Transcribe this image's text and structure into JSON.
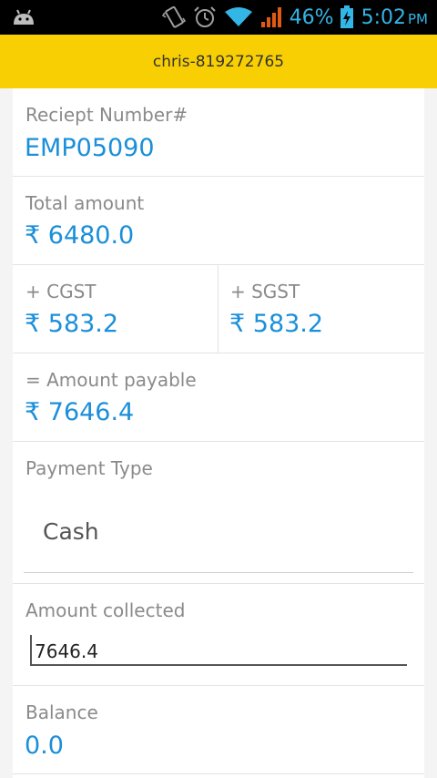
{
  "status_bar": {
    "battery_percent": "46%",
    "time": "5:02",
    "ampm": "PM",
    "icons": [
      "android-icon",
      "vibrate-icon",
      "alarm-icon",
      "wifi-icon",
      "signal-icon",
      "battery-charging-icon"
    ]
  },
  "header": {
    "title": "chris-819272765"
  },
  "receipt": {
    "label": "Reciept Number#",
    "value": "EMP05090"
  },
  "total": {
    "label": "Total amount",
    "value": "₹ 6480.0"
  },
  "cgst": {
    "label": "+ CGST",
    "value": "₹ 583.2"
  },
  "sgst": {
    "label": "+ SGST",
    "value": "₹ 583.2"
  },
  "payable": {
    "label": "= Amount payable",
    "value": "₹ 7646.4"
  },
  "payment_type": {
    "label": "Payment Type",
    "selected": "Cash"
  },
  "amount_collected": {
    "label": "Amount collected",
    "value": "7646.4"
  },
  "balance": {
    "label": "Balance",
    "value": "0.0"
  },
  "colors": {
    "accent_blue": "#1b8fd9",
    "header_yellow": "#f8cf03",
    "status_blue": "#33b5e5"
  }
}
